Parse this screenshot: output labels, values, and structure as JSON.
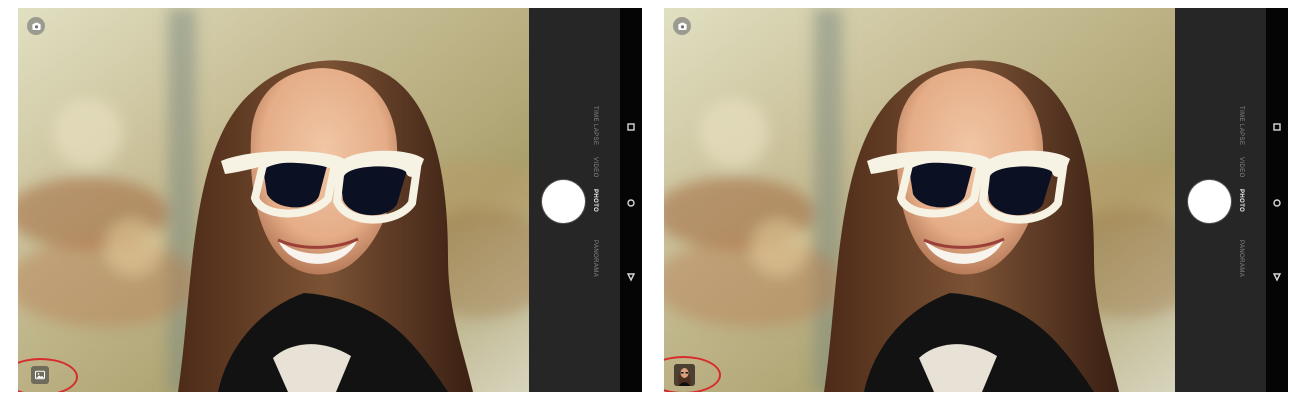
{
  "screens": [
    {
      "camera_icon": "camera-icon",
      "thumbnail_icon": "gallery-icon",
      "highlight": "red-circle",
      "modes": [
        "Time Lapse",
        "Video",
        "Photo",
        "Panorama"
      ],
      "active_mode": "Photo"
    },
    {
      "camera_icon": "camera-icon",
      "thumbnail_icon": "photo-thumbnail",
      "highlight": "red-circle",
      "modes": [
        "Time Lapse",
        "Video",
        "Photo",
        "Panorama"
      ],
      "active_mode": "Photo"
    }
  ],
  "navigation": {
    "recent_apps_icon": "square-icon",
    "home_icon": "circle-icon",
    "back_icon": "triangle-icon"
  },
  "colors": {
    "highlight_ring": "#d82b2b",
    "control_panel": "#262626",
    "nav_bar": "#050505",
    "shutter": "#ffffff",
    "active_mode_text": "#f2f2f2",
    "inactive_mode_text": "#8a8a8a"
  }
}
